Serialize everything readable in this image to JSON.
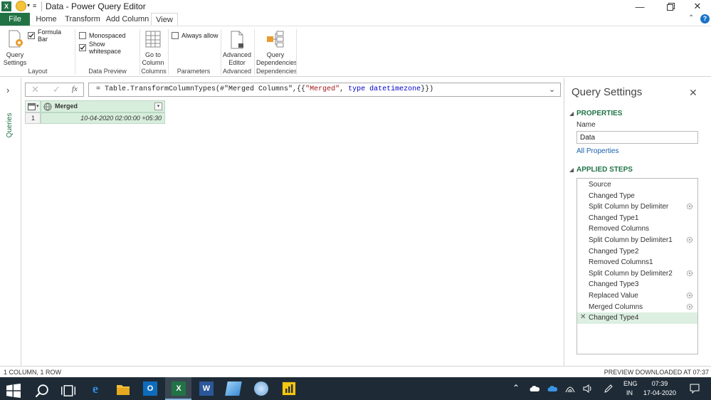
{
  "window": {
    "title": "Data - Power Query Editor"
  },
  "tabs": [
    {
      "label": "File"
    },
    {
      "label": "Home"
    },
    {
      "label": "Transform"
    },
    {
      "label": "Add Column"
    },
    {
      "label": "View"
    }
  ],
  "ribbon": {
    "query_settings": {
      "line1": "Query",
      "line2": "Settings"
    },
    "formula_bar_label": "Formula Bar",
    "group_layout": "Layout",
    "monospaced_label": "Monospaced",
    "show_whitespace_label": "Show whitespace",
    "group_data_preview": "Data Preview",
    "go_to_column": {
      "line1": "Go to",
      "line2": "Column"
    },
    "group_columns": "Columns",
    "always_allow_label": "Always allow",
    "group_parameters": "Parameters",
    "advanced_editor": {
      "line1": "Advanced",
      "line2": "Editor"
    },
    "group_advanced": "Advanced",
    "query_dependencies": {
      "line1": "Query",
      "line2": "Dependencies"
    },
    "group_dependencies": "Dependencies"
  },
  "queries_pane": {
    "label": "Queries"
  },
  "formula": {
    "fx": "fx",
    "text_before": "= Table.TransformColumnTypes(#\"Merged Columns\",{{",
    "text_string": "\"Merged\"",
    "text_mid": ", ",
    "text_keyword": "type datetimezone",
    "text_after": "}})"
  },
  "grid": {
    "column_header": "Merged",
    "rows": [
      {
        "index": "1",
        "value": "10-04-2020 02:00:00 +05:30"
      }
    ]
  },
  "settings": {
    "title": "Query Settings",
    "properties_header": "PROPERTIES",
    "name_label": "Name",
    "name_value": "Data",
    "all_properties_link": "All Properties",
    "applied_steps_header": "APPLIED STEPS",
    "steps": [
      {
        "label": "Source",
        "gear": false
      },
      {
        "label": "Changed Type",
        "gear": false
      },
      {
        "label": "Split Column by Delimiter",
        "gear": true
      },
      {
        "label": "Changed Type1",
        "gear": false
      },
      {
        "label": "Removed Columns",
        "gear": false
      },
      {
        "label": "Split Column by Delimiter1",
        "gear": true
      },
      {
        "label": "Changed Type2",
        "gear": false
      },
      {
        "label": "Removed Columns1",
        "gear": false
      },
      {
        "label": "Split Column by Delimiter2",
        "gear": true
      },
      {
        "label": "Changed Type3",
        "gear": false
      },
      {
        "label": "Replaced Value",
        "gear": true
      },
      {
        "label": "Merged Columns",
        "gear": true
      },
      {
        "label": "Changed Type4",
        "gear": false,
        "selected": true
      }
    ]
  },
  "status": {
    "left": "1 COLUMN, 1 ROW",
    "right": "PREVIEW DOWNLOADED AT 07:37"
  },
  "taskbar": {
    "lang1": "ENG",
    "lang2": "IN",
    "time": "07:39",
    "date": "17-04-2020"
  },
  "colors": {
    "accent_green": "#217346",
    "selected_step_bg": "#dcefe1",
    "grid_cell_bg": "#d8eedd",
    "taskbar_bg": "#1e2b36",
    "link_blue": "#1a5fa8"
  }
}
